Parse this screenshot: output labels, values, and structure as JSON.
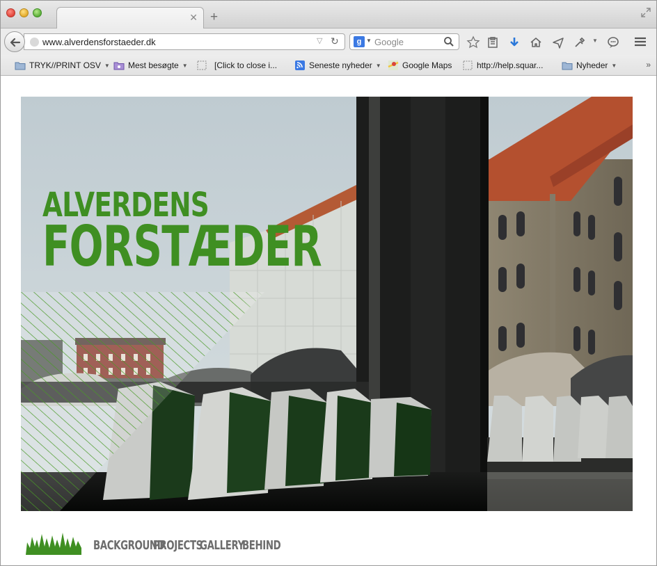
{
  "browser": {
    "tab_title": "",
    "address": "www.alverdensforstaeder.dk",
    "search_engine": "Google",
    "search_placeholder": "Google"
  },
  "bookmarks": [
    {
      "label": "TRYK//PRINT OSV",
      "icon": "folder-icon",
      "has_menu": true
    },
    {
      "label": "Mest besøgte",
      "icon": "smart-folder-icon",
      "has_menu": true
    },
    {
      "label": "[Click to close i...",
      "icon": "page-icon",
      "has_menu": false
    },
    {
      "label": "Seneste nyheder",
      "icon": "rss-icon",
      "has_menu": true
    },
    {
      "label": "Google Maps",
      "icon": "maps-icon",
      "has_menu": false
    },
    {
      "label": "http://help.squar...",
      "icon": "page-icon",
      "has_menu": false
    },
    {
      "label": "Nyheder",
      "icon": "folder-icon",
      "has_menu": true
    }
  ],
  "page": {
    "brand_line1": "ALVERDENS",
    "brand_line2": "FORSTÆDER",
    "brand_color": "#3f8f22",
    "nav": [
      {
        "label": "BACKGROUND"
      },
      {
        "label": "PROJECTS"
      },
      {
        "label": "GALLERY"
      },
      {
        "label": "BEHIND"
      }
    ]
  }
}
